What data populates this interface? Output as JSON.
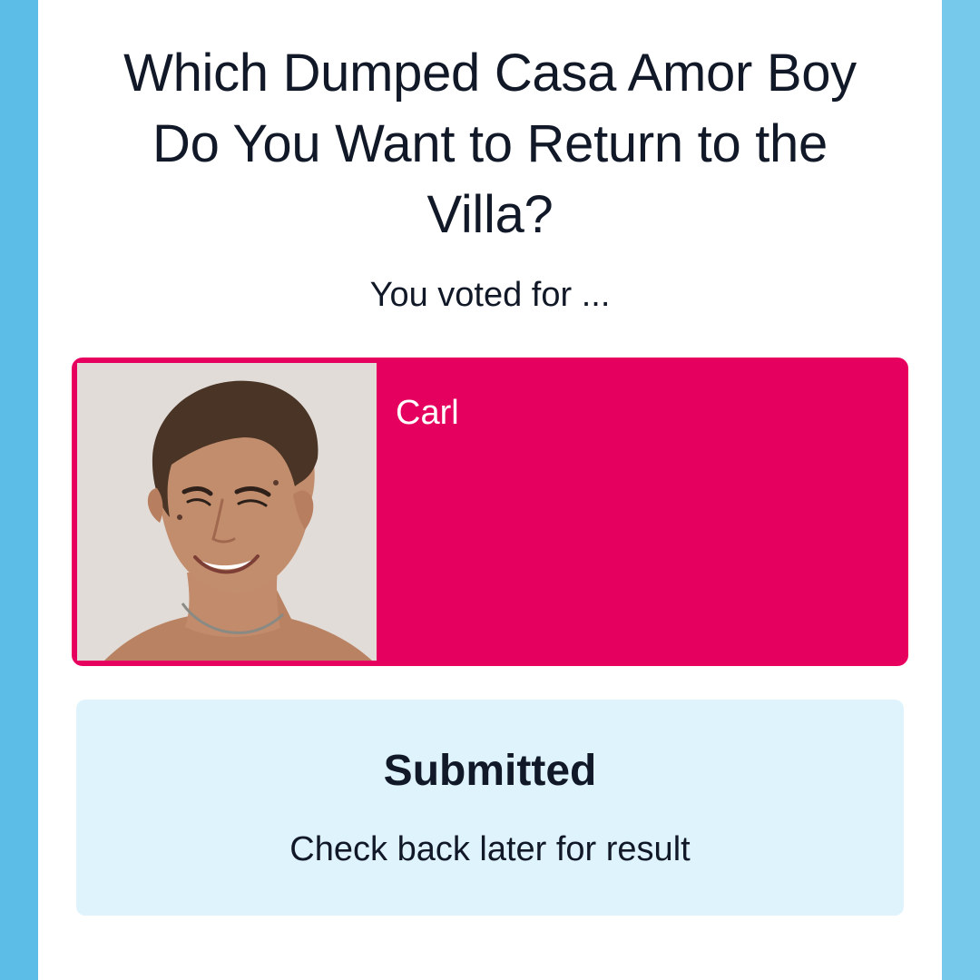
{
  "poll": {
    "title": "Which Dumped Casa Amor Boy Do You Want to Return to the Villa?",
    "voted_label": "You voted for ..."
  },
  "selected_candidate": {
    "name": "Carl",
    "photo_icon": "contestant-photo"
  },
  "status": {
    "title": "Submitted",
    "message": "Check back later for result"
  },
  "colors": {
    "background_left": "#5cbde6",
    "background_right": "#76c9ea",
    "card_accent": "#e5005f",
    "status_background": "#dff3fc",
    "text": "#111827"
  }
}
